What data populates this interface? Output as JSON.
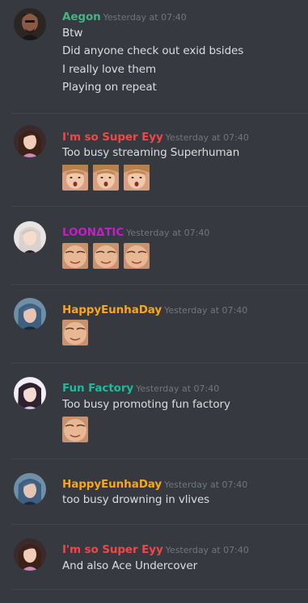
{
  "colors": {
    "background": "#36393f",
    "divider": "#42454a",
    "text": "#dcddde",
    "timestamp": "#72767d"
  },
  "messages": [
    {
      "username": "Aegon",
      "username_color": "#43b581",
      "timestamp": "Yesterday at 07:40",
      "avatar": "avatar-aegon",
      "lines": [
        "Btw",
        "Did anyone check out exid bsides",
        "I really love them",
        "Playing on repeat"
      ],
      "emojis": []
    },
    {
      "username": "I'm so Super Eyy",
      "username_color": "#f04747",
      "timestamp": "Yesterday at 07:40",
      "avatar": "avatar-super-eyy",
      "lines": [
        "Too busy streaming Superhuman"
      ],
      "emojis": [
        "surprised-face-emoji",
        "surprised-face-emoji",
        "surprised-face-emoji"
      ]
    },
    {
      "username": "LOONΔTIC",
      "username_color": "#c21fc9",
      "timestamp": "Yesterday at 07:40",
      "avatar": "avatar-loonatic",
      "lines": [],
      "emojis": [
        "smiling-face-emoji",
        "smiling-face-emoji",
        "smiling-face-emoji"
      ]
    },
    {
      "username": "HappyEunhaDay",
      "username_color": "#faa61a",
      "timestamp": "Yesterday at 07:40",
      "avatar": "avatar-happyeunhaday",
      "lines": [],
      "emojis": [
        "smiling-face-emoji"
      ]
    },
    {
      "username": "Fun Factory",
      "username_color": "#1abc9c",
      "timestamp": "Yesterday at 07:40",
      "avatar": "avatar-fun-factory",
      "lines": [
        "Too busy promoting fun factory"
      ],
      "emojis": [
        "smiling-face-emoji"
      ]
    },
    {
      "username": "HappyEunhaDay",
      "username_color": "#faa61a",
      "timestamp": "Yesterday at 07:40",
      "avatar": "avatar-happyeunhaday",
      "lines": [
        "too busy drowning in vlives"
      ],
      "emojis": []
    },
    {
      "username": "I'm so Super Eyy",
      "username_color": "#f04747",
      "timestamp": "Yesterday at 07:40",
      "avatar": "avatar-super-eyy",
      "lines": [
        "And also Ace Undercover"
      ],
      "emojis": []
    }
  ]
}
